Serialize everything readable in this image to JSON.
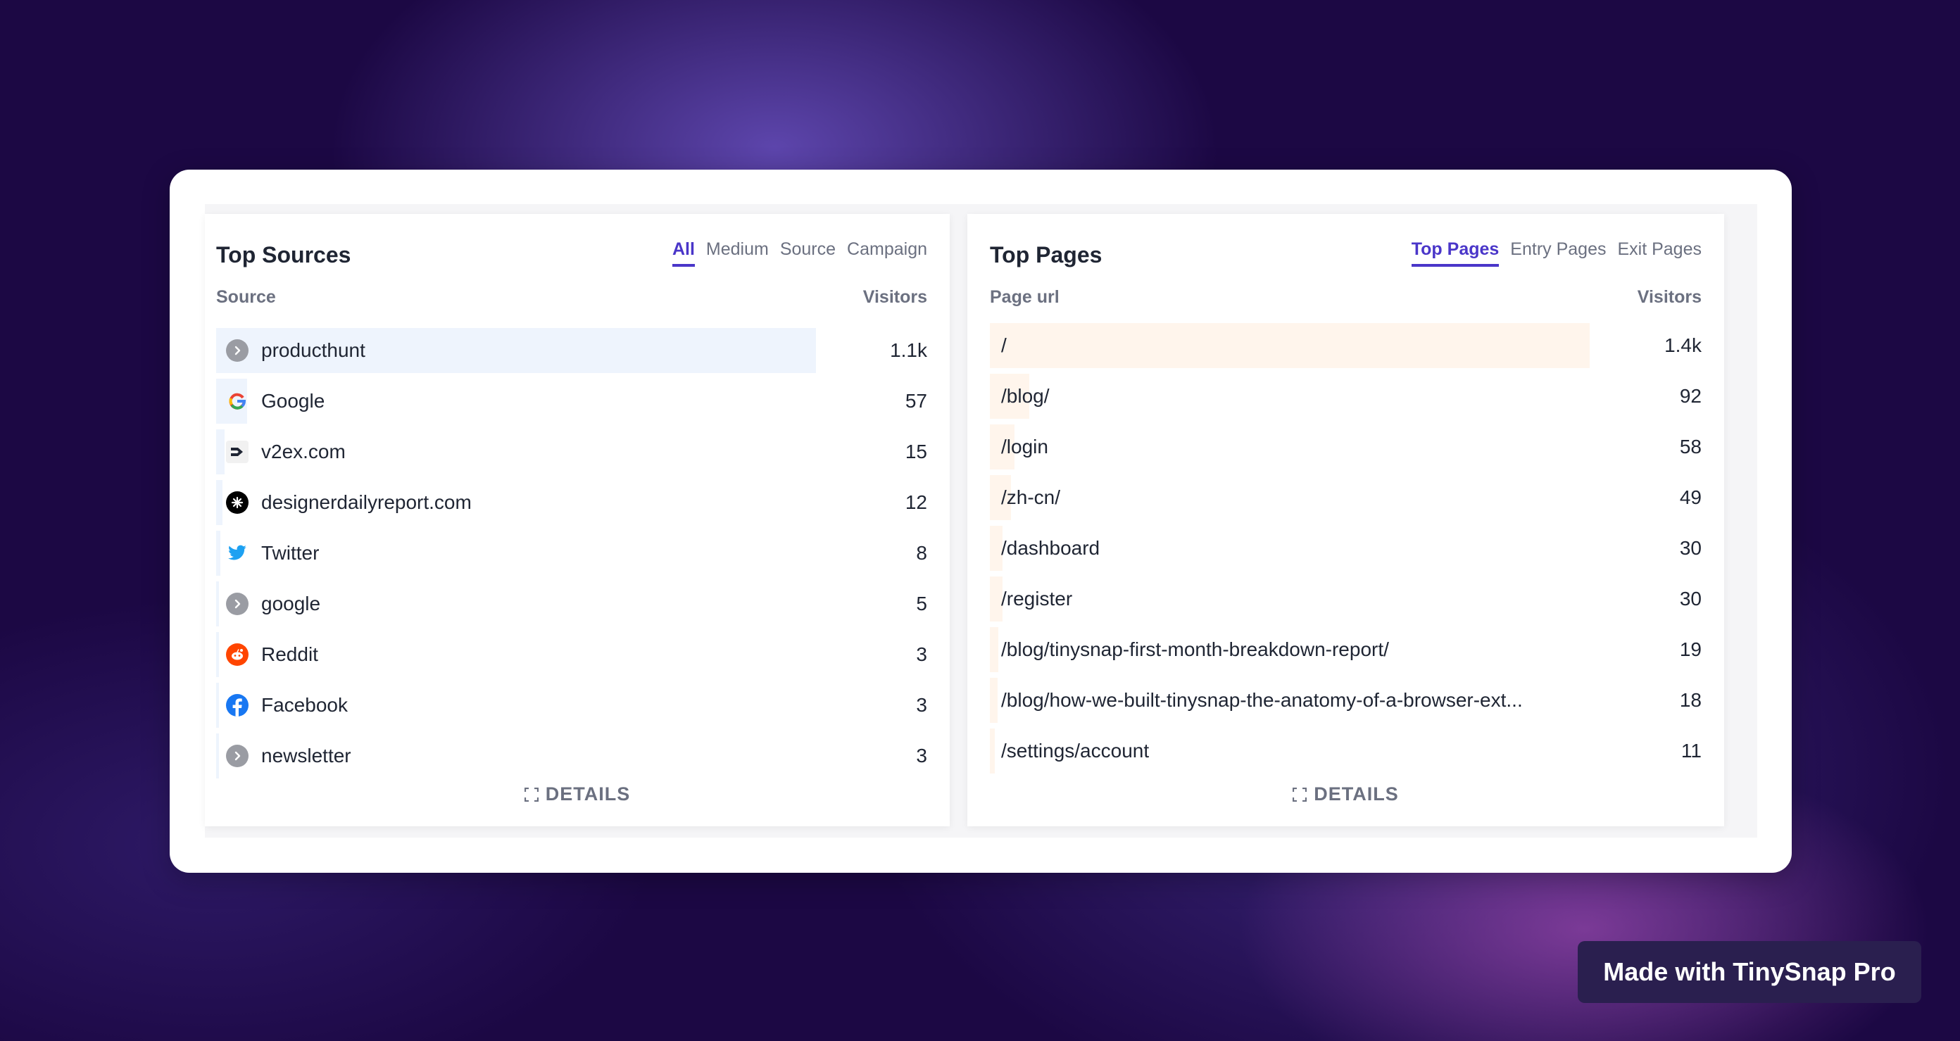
{
  "top_sources": {
    "title": "Top Sources",
    "tabs": [
      {
        "label": "All",
        "active": true
      },
      {
        "label": "Medium",
        "active": false
      },
      {
        "label": "Source",
        "active": false
      },
      {
        "label": "Campaign",
        "active": false
      }
    ],
    "columns": {
      "source": "Source",
      "visitors": "Visitors"
    },
    "rows": [
      {
        "label": "producthunt",
        "value": "1.1k",
        "share": 1.0,
        "icon": "chevron-right-icon"
      },
      {
        "label": "Google",
        "value": "57",
        "share": 0.052,
        "icon": "google-icon"
      },
      {
        "label": "v2ex.com",
        "value": "15",
        "share": 0.014,
        "icon": "v2ex-icon"
      },
      {
        "label": "designerdailyreport.com",
        "value": "12",
        "share": 0.011,
        "icon": "designer-daily-icon"
      },
      {
        "label": "Twitter",
        "value": "8",
        "share": 0.007,
        "icon": "twitter-icon"
      },
      {
        "label": "google",
        "value": "5",
        "share": 0.005,
        "icon": "chevron-right-icon"
      },
      {
        "label": "Reddit",
        "value": "3",
        "share": 0.003,
        "icon": "reddit-icon"
      },
      {
        "label": "Facebook",
        "value": "3",
        "share": 0.003,
        "icon": "facebook-icon"
      },
      {
        "label": "newsletter",
        "value": "3",
        "share": 0.003,
        "icon": "chevron-right-icon"
      }
    ],
    "details_label": "DETAILS",
    "bar_color": "#eef4fd"
  },
  "top_pages": {
    "title": "Top Pages",
    "tabs": [
      {
        "label": "Top Pages",
        "active": true
      },
      {
        "label": "Entry Pages",
        "active": false
      },
      {
        "label": "Exit Pages",
        "active": false
      }
    ],
    "columns": {
      "url": "Page url",
      "visitors": "Visitors"
    },
    "rows": [
      {
        "label": "/",
        "value": "1.4k",
        "share": 1.0
      },
      {
        "label": "/blog/",
        "value": "92",
        "share": 0.066
      },
      {
        "label": "/login",
        "value": "58",
        "share": 0.041
      },
      {
        "label": "/zh-cn/",
        "value": "49",
        "share": 0.035
      },
      {
        "label": "/dashboard",
        "value": "30",
        "share": 0.021
      },
      {
        "label": "/register",
        "value": "30",
        "share": 0.021
      },
      {
        "label": "/blog/tinysnap-first-month-breakdown-report/",
        "value": "19",
        "share": 0.014
      },
      {
        "label": "/blog/how-we-built-tinysnap-the-anatomy-of-a-browser-ext...",
        "value": "18",
        "share": 0.013
      },
      {
        "label": "/settings/account",
        "value": "11",
        "share": 0.008
      }
    ],
    "details_label": "DETAILS",
    "bar_color": "#fff5ec"
  },
  "watermark": "Made with TinySnap Pro",
  "accent_color": "#4a36c9"
}
